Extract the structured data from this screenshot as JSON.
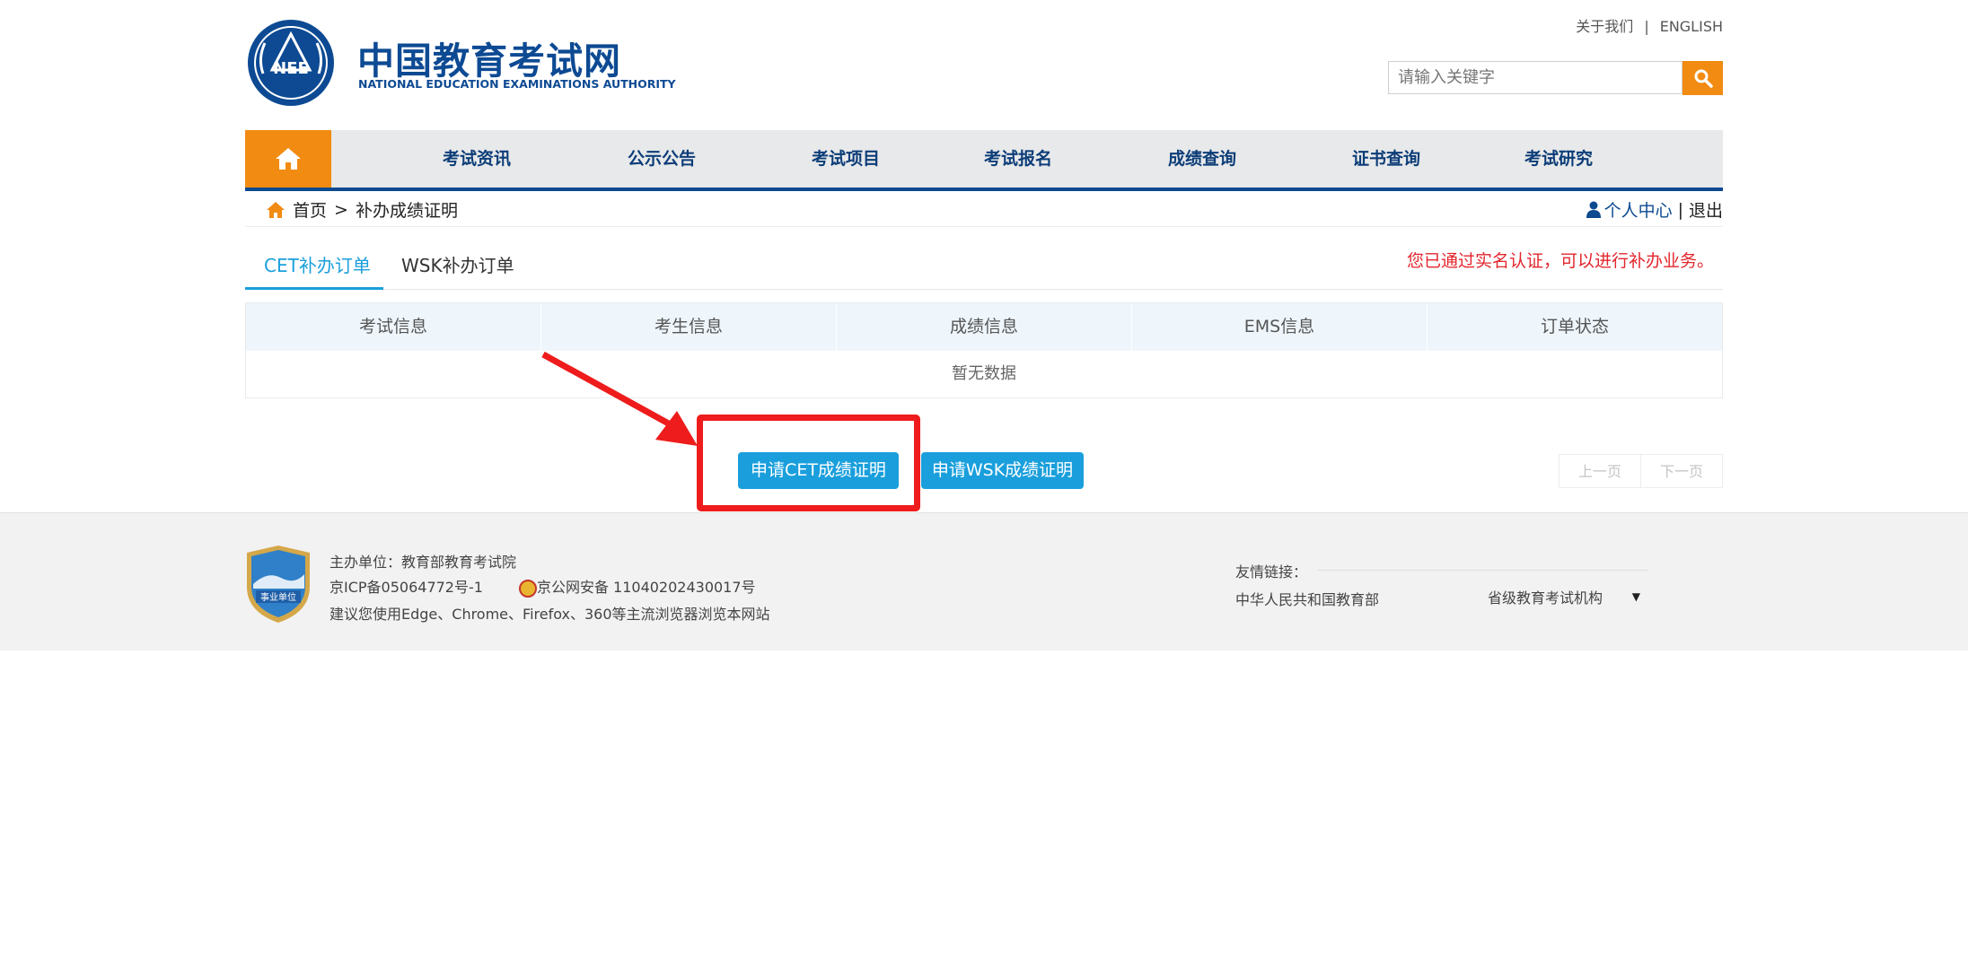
{
  "site": {
    "name_cn": "中国教育考试网",
    "name_en": "NATIONAL EDUCATION EXAMINATIONS AUTHORITY",
    "emblem_text": "NEE"
  },
  "top_links": {
    "about": "关于我们",
    "separator": "|",
    "english": "ENGLISH"
  },
  "search": {
    "placeholder": "请输入关键字",
    "value": ""
  },
  "nav": {
    "items": [
      "考试资讯",
      "公示公告",
      "考试项目",
      "考试报名",
      "成绩查询",
      "证书查询",
      "考试研究"
    ]
  },
  "breadcrumb": {
    "home": "首页",
    "separator": ">",
    "current": "补办成绩证明"
  },
  "user": {
    "center": "个人中心",
    "separator": "|",
    "logout": "退出"
  },
  "tabs": [
    "CET补办订单",
    "WSK补办订单"
  ],
  "notice": "您已通过实名认证，可以进行补办业务。",
  "table": {
    "headers": [
      "考试信息",
      "考生信息",
      "成绩信息",
      "EMS信息",
      "订单状态"
    ],
    "empty_text": "暂无数据"
  },
  "actions": {
    "apply_cet": "申请CET成绩证明",
    "apply_wsk": "申请WSK成绩证明"
  },
  "pagination": {
    "prev": "上一页",
    "next": "下一页"
  },
  "footer": {
    "organizer": "主办单位：教育部教育考试院",
    "icp": "京ICP备05064772号-1",
    "police": "京公网安备 11040202430017号",
    "browser_tip": "建议您使用Edge、Chrome、Firefox、360等主流浏览器浏览本网站",
    "badge_text": "事业单位",
    "links_title": "友情链接：",
    "links": [
      "中华人民共和国教育部"
    ],
    "provincial_select": "省级教育考试机构"
  },
  "colors": {
    "brand_blue": "#0c4a90",
    "accent_orange": "#f28b12",
    "button_blue": "#1a9fdc",
    "notice_red": "#e3262d",
    "highlight_red": "#ee1c1c"
  },
  "icons": [
    "home-icon",
    "search-icon",
    "user-icon",
    "police-badge-icon",
    "chevron-down-icon"
  ]
}
